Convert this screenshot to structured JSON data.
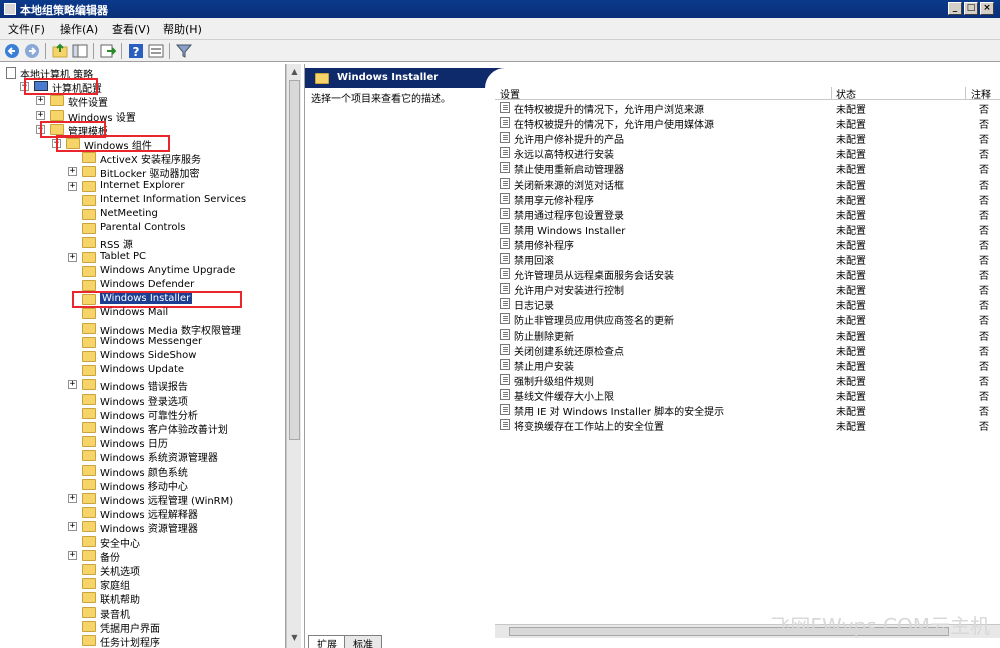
{
  "window": {
    "title": "本地组策略编辑器"
  },
  "menu": [
    "文件(F)",
    "操作(A)",
    "查看(V)",
    "帮助(H)"
  ],
  "toolbar": [
    "back-icon",
    "forward-icon",
    "up-icon",
    "show-hide-tree-icon",
    "export-icon",
    "help-icon",
    "properties-icon",
    "filter-icon"
  ],
  "tree": [
    {
      "label": "本地计算机 策略",
      "level": 0,
      "icon": "policy-icon",
      "exp": ""
    },
    {
      "label": "计算机配置",
      "level": 1,
      "icon": "computer-icon",
      "exp": "−",
      "highlight": true
    },
    {
      "label": "软件设置",
      "level": 2,
      "icon": "folder-icon",
      "exp": "+"
    },
    {
      "label": "Windows 设置",
      "level": 2,
      "icon": "folder-icon",
      "exp": "+"
    },
    {
      "label": "管理模板",
      "level": 2,
      "icon": "folder-icon",
      "exp": "−",
      "highlight": true
    },
    {
      "label": "Windows 组件",
      "level": 3,
      "icon": "folder-icon",
      "exp": "−",
      "highlight": true
    },
    {
      "label": "ActiveX 安装程序服务",
      "level": 4,
      "icon": "folder-icon",
      "exp": ""
    },
    {
      "label": "BitLocker 驱动器加密",
      "level": 4,
      "icon": "folder-icon",
      "exp": "+"
    },
    {
      "label": "Internet Explorer",
      "level": 4,
      "icon": "folder-icon",
      "exp": "+"
    },
    {
      "label": "Internet Information Services",
      "level": 4,
      "icon": "folder-icon",
      "exp": ""
    },
    {
      "label": "NetMeeting",
      "level": 4,
      "icon": "folder-icon",
      "exp": ""
    },
    {
      "label": "Parental Controls",
      "level": 4,
      "icon": "folder-icon",
      "exp": ""
    },
    {
      "label": "RSS 源",
      "level": 4,
      "icon": "folder-icon",
      "exp": ""
    },
    {
      "label": "Tablet PC",
      "level": 4,
      "icon": "folder-icon",
      "exp": "+"
    },
    {
      "label": "Windows Anytime Upgrade",
      "level": 4,
      "icon": "folder-icon",
      "exp": ""
    },
    {
      "label": "Windows Defender",
      "level": 4,
      "icon": "folder-icon",
      "exp": ""
    },
    {
      "label": "Windows Installer",
      "level": 4,
      "icon": "folder-icon",
      "exp": "",
      "selected": true,
      "highlight": true
    },
    {
      "label": "Windows Mail",
      "level": 4,
      "icon": "folder-icon",
      "exp": ""
    },
    {
      "label": "Windows Media 数字权限管理",
      "level": 4,
      "icon": "folder-icon",
      "exp": ""
    },
    {
      "label": "Windows Messenger",
      "level": 4,
      "icon": "folder-icon",
      "exp": ""
    },
    {
      "label": "Windows SideShow",
      "level": 4,
      "icon": "folder-icon",
      "exp": ""
    },
    {
      "label": "Windows Update",
      "level": 4,
      "icon": "folder-icon",
      "exp": ""
    },
    {
      "label": "Windows 错误报告",
      "level": 4,
      "icon": "folder-icon",
      "exp": "+"
    },
    {
      "label": "Windows 登录选项",
      "level": 4,
      "icon": "folder-icon",
      "exp": ""
    },
    {
      "label": "Windows 可靠性分析",
      "level": 4,
      "icon": "folder-icon",
      "exp": ""
    },
    {
      "label": "Windows 客户体验改善计划",
      "level": 4,
      "icon": "folder-icon",
      "exp": ""
    },
    {
      "label": "Windows 日历",
      "level": 4,
      "icon": "folder-icon",
      "exp": ""
    },
    {
      "label": "Windows 系统资源管理器",
      "level": 4,
      "icon": "folder-icon",
      "exp": ""
    },
    {
      "label": "Windows 颜色系统",
      "level": 4,
      "icon": "folder-icon",
      "exp": ""
    },
    {
      "label": "Windows 移动中心",
      "level": 4,
      "icon": "folder-icon",
      "exp": ""
    },
    {
      "label": "Windows 远程管理 (WinRM)",
      "level": 4,
      "icon": "folder-icon",
      "exp": "+"
    },
    {
      "label": "Windows 远程解释器",
      "level": 4,
      "icon": "folder-icon",
      "exp": ""
    },
    {
      "label": "Windows 资源管理器",
      "level": 4,
      "icon": "folder-icon",
      "exp": "+"
    },
    {
      "label": "安全中心",
      "level": 4,
      "icon": "folder-icon",
      "exp": ""
    },
    {
      "label": "备份",
      "level": 4,
      "icon": "folder-icon",
      "exp": "+"
    },
    {
      "label": "关机选项",
      "level": 4,
      "icon": "folder-icon",
      "exp": ""
    },
    {
      "label": "家庭组",
      "level": 4,
      "icon": "folder-icon",
      "exp": ""
    },
    {
      "label": "联机帮助",
      "level": 4,
      "icon": "folder-icon",
      "exp": ""
    },
    {
      "label": "录音机",
      "level": 4,
      "icon": "folder-icon",
      "exp": ""
    },
    {
      "label": "凭据用户界面",
      "level": 4,
      "icon": "folder-icon",
      "exp": ""
    },
    {
      "label": "任务计划程序",
      "level": 4,
      "icon": "folder-icon",
      "exp": ""
    }
  ],
  "right": {
    "header": "Windows Installer",
    "description": "选择一个项目来查看它的描述。",
    "columns": {
      "setting": "设置",
      "state": "状态",
      "comment": "注释"
    },
    "policies": [
      {
        "name": "在特权被提升的情况下，允许用户浏览来源",
        "state": "未配置",
        "comment": "否"
      },
      {
        "name": "在特权被提升的情况下，允许用户使用媒体源",
        "state": "未配置",
        "comment": "否"
      },
      {
        "name": "允许用户修补提升的产品",
        "state": "未配置",
        "comment": "否"
      },
      {
        "name": "永远以高特权进行安装",
        "state": "未配置",
        "comment": "否"
      },
      {
        "name": "禁止使用重新启动管理器",
        "state": "未配置",
        "comment": "否"
      },
      {
        "name": "关闭新来源的浏览对话框",
        "state": "未配置",
        "comment": "否"
      },
      {
        "name": "禁用享元修补程序",
        "state": "未配置",
        "comment": "否"
      },
      {
        "name": "禁用通过程序包设置登录",
        "state": "未配置",
        "comment": "否"
      },
      {
        "name": "禁用 Windows Installer",
        "state": "未配置",
        "comment": "否"
      },
      {
        "name": "禁用修补程序",
        "state": "未配置",
        "comment": "否"
      },
      {
        "name": "禁用回滚",
        "state": "未配置",
        "comment": "否"
      },
      {
        "name": "允许管理员从远程桌面服务会话安装",
        "state": "未配置",
        "comment": "否"
      },
      {
        "name": "允许用户对安装进行控制",
        "state": "未配置",
        "comment": "否"
      },
      {
        "name": "日志记录",
        "state": "未配置",
        "comment": "否"
      },
      {
        "name": "防止非管理员应用供应商签名的更新",
        "state": "未配置",
        "comment": "否"
      },
      {
        "name": "防止删除更新",
        "state": "未配置",
        "comment": "否"
      },
      {
        "name": "关闭创建系统还原检查点",
        "state": "未配置",
        "comment": "否"
      },
      {
        "name": "禁止用户安装",
        "state": "未配置",
        "comment": "否"
      },
      {
        "name": "强制升级组件规则",
        "state": "未配置",
        "comment": "否"
      },
      {
        "name": "基线文件缓存大小上限",
        "state": "未配置",
        "comment": "否"
      },
      {
        "name": "禁用 IE 对 Windows Installer 脚本的安全提示",
        "state": "未配置",
        "comment": "否"
      },
      {
        "name": "将变换缓存在工作站上的安全位置",
        "state": "未配置",
        "comment": "否"
      }
    ]
  },
  "tabs": [
    "扩展",
    "标准"
  ],
  "watermark": "飞网FWvps.COM云主机",
  "colors": {
    "title_bar": "#0b3a8c",
    "header_bar": "#0f2a6b",
    "selection": "#1c3f94",
    "highlight_box": "#e8262c",
    "folder": "#f7d46a"
  }
}
